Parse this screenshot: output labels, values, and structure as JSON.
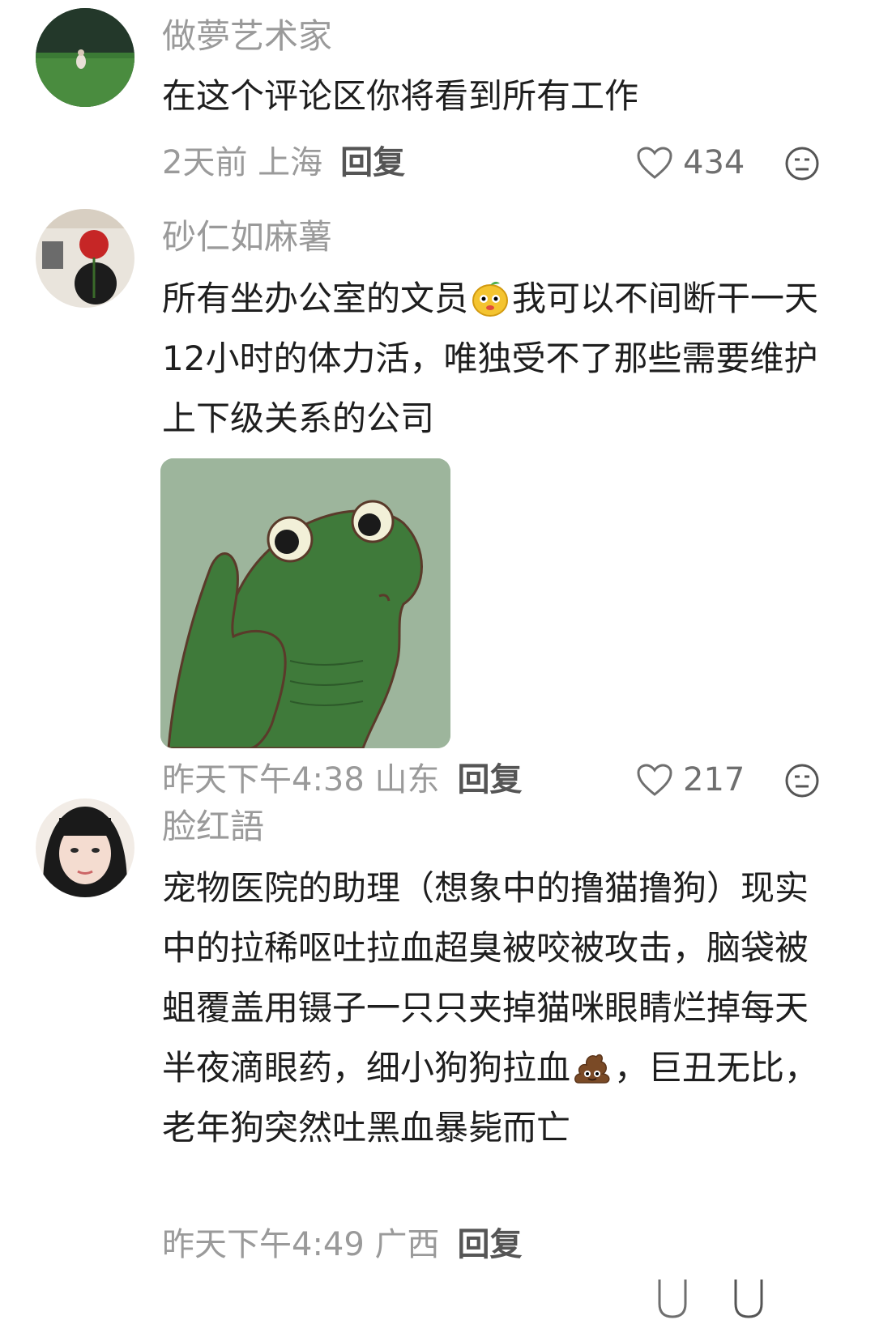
{
  "comments": [
    {
      "username": "做夢艺术家",
      "text": "在这个评论区你将看到所有工作",
      "time_location": "2天前 上海",
      "reply_label": "回复",
      "likes": "434",
      "avatar_icon": "avatar-photo-field",
      "like_icon": "heart-outline-icon",
      "react_icon": "neutral-face-icon"
    },
    {
      "username": "砂仁如麻薯",
      "text_parts": [
        "所有坐办公室的文员",
        "我可以不间断干一天12小时的体力活，唯独受不了那些需要维护上下级关系的公司"
      ],
      "inline_emoji": "cute-orange-face-emoji",
      "image": "frog-meme-image",
      "time_location": "昨天下午4:38 山东",
      "reply_label": "回复",
      "likes": "217",
      "like_icon": "heart-outline-icon",
      "react_icon": "neutral-face-icon"
    },
    {
      "username": "脸红語",
      "text_parts": [
        "宠物医院的助理（想象中的撸猫撸狗）现实中的拉稀呕吐拉血超臭被咬被攻击，脑袋被蛆覆盖用镊子一只只夹掉猫咪眼睛烂掉每天半夜滴眼药，细小狗狗拉血",
        "，巨丑无比，老年狗突然吐黑血暴毙而亡"
      ],
      "inline_emoji": "poop-emoji",
      "time_location": "昨天下午4:49 广西",
      "reply_label": "回复"
    }
  ],
  "colors": {
    "secondary_text": "#9a9a9a",
    "primary_text": "#1e1e1e",
    "frog_bg": "#9db59c",
    "frog_green": "#3f7a3a"
  }
}
